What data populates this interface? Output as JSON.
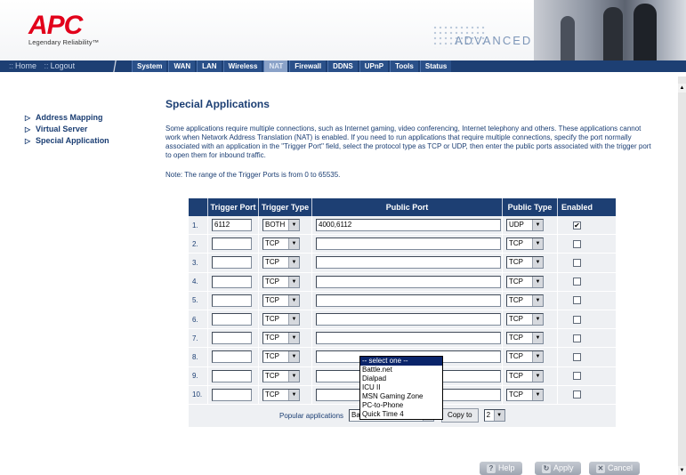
{
  "header": {
    "logo_text": "APC",
    "logo_tagline": "Legendary Reliability™",
    "advanced_setup": "ADVANCED SETUP"
  },
  "nav": {
    "home": "Home",
    "logout": "Logout",
    "tabs": [
      "System",
      "WAN",
      "LAN",
      "Wireless",
      "NAT",
      "Firewall",
      "DDNS",
      "UPnP",
      "Tools",
      "Status"
    ],
    "active_tab": "NAT"
  },
  "left_menu": [
    "Address Mapping",
    "Virtual Server",
    "Special Application"
  ],
  "content": {
    "title": "Special Applications",
    "description": "Some applications require multiple connections, such as Internet gaming, video conferencing, Internet telephony and others. These applications cannot work when Network Address Translation (NAT) is enabled. If you need to run applications that require multiple connections, specify the port normally associated with an application in the \"Trigger Port\" field, select the protocol type as TCP or UDP, then enter the public ports associated with the trigger port to open them for inbound traffic.",
    "note": "Note: The range of the Trigger Ports is from 0 to 65535."
  },
  "table": {
    "headers": [
      "",
      "Trigger Port",
      "Trigger Type",
      "Public Port",
      "Public Type",
      "Enabled"
    ],
    "rows": [
      {
        "num": "1.",
        "trigger_port": "6112",
        "trigger_type": "BOTH",
        "public_port": "4000,6112",
        "public_type": "UDP",
        "enabled": "✔"
      },
      {
        "num": "2.",
        "trigger_port": "",
        "trigger_type": "TCP",
        "public_port": "",
        "public_type": "TCP",
        "enabled": ""
      },
      {
        "num": "3.",
        "trigger_port": "",
        "trigger_type": "TCP",
        "public_port": "",
        "public_type": "TCP",
        "enabled": ""
      },
      {
        "num": "4.",
        "trigger_port": "",
        "trigger_type": "TCP",
        "public_port": "",
        "public_type": "TCP",
        "enabled": ""
      },
      {
        "num": "5.",
        "trigger_port": "",
        "trigger_type": "TCP",
        "public_port": "",
        "public_type": "TCP",
        "enabled": ""
      },
      {
        "num": "6.",
        "trigger_port": "",
        "trigger_type": "TCP",
        "public_port": "",
        "public_type": "TCP",
        "enabled": ""
      },
      {
        "num": "7.",
        "trigger_port": "",
        "trigger_type": "TCP",
        "public_port": "",
        "public_type": "TCP",
        "enabled": ""
      },
      {
        "num": "8.",
        "trigger_port": "",
        "trigger_type": "TCP",
        "public_port": "",
        "public_type": "TCP",
        "enabled": ""
      },
      {
        "num": "9.",
        "trigger_port": "",
        "trigger_type": "TCP",
        "public_port": "",
        "public_type": "TCP",
        "enabled": ""
      },
      {
        "num": "10.",
        "trigger_port": "",
        "trigger_type": "TCP",
        "public_port": "",
        "public_type": "TCP",
        "enabled": ""
      }
    ],
    "popular_label": "Popular applications",
    "popular_selected": "Battle.net",
    "copy_button": "Copy to",
    "copy_target": "2"
  },
  "dropdown_options": [
    "-- select one --",
    "Battle.net",
    "Dialpad",
    "ICU II",
    "MSN Gaming Zone",
    "PC-to-Phone",
    "Quick Time 4"
  ],
  "buttons": {
    "help": "Help",
    "apply": "Apply",
    "cancel": "Cancel"
  },
  "colors": {
    "navy": "#1d3f73",
    "brand_red": "#e2001a",
    "row_bg": "#eef0f3"
  }
}
